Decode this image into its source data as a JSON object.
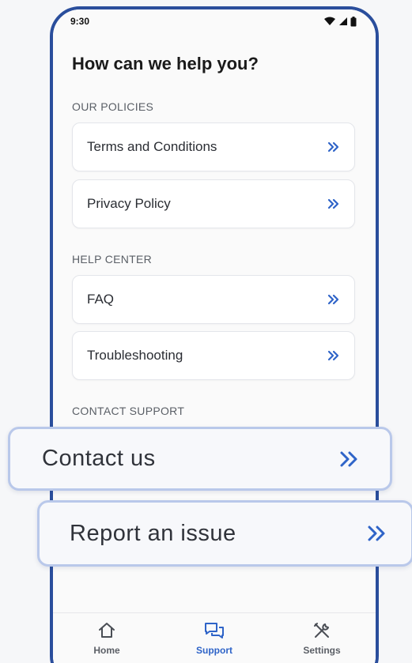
{
  "status_bar": {
    "time": "9:30"
  },
  "page_title": "How can we help you?",
  "sections": {
    "policies": {
      "label": "OUR POLICIES",
      "items": [
        {
          "label": "Terms and Conditions"
        },
        {
          "label": "Privacy Policy"
        }
      ]
    },
    "help_center": {
      "label": "HELP CENTER",
      "items": [
        {
          "label": "FAQ"
        },
        {
          "label": "Troubleshooting"
        }
      ]
    },
    "contact_support": {
      "label": "CONTACT SUPPORT",
      "items": [
        {
          "label": "Contact us"
        },
        {
          "label": "Report an issue"
        }
      ]
    }
  },
  "bottom_nav": {
    "items": [
      {
        "label": "Home",
        "icon": "home-icon"
      },
      {
        "label": "Support",
        "icon": "chat-icon"
      },
      {
        "label": "Settings",
        "icon": "tools-icon"
      }
    ],
    "active": "Support"
  },
  "colors": {
    "accent": "#2f64c8",
    "frame": "#2a4e9c",
    "callout_border": "#b9c8ea"
  }
}
